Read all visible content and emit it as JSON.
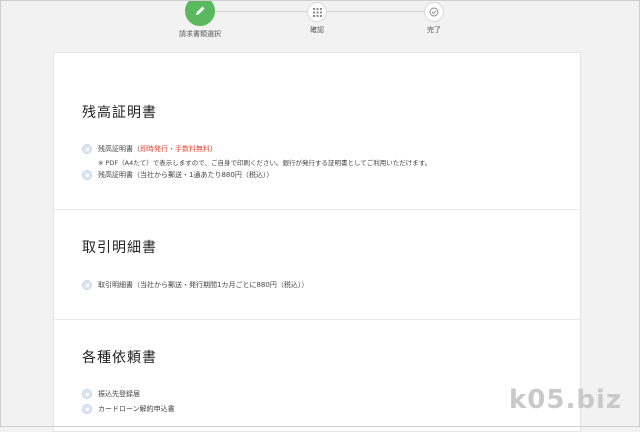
{
  "stepper": {
    "steps": [
      {
        "label": "請求書類選択",
        "icon": "pencil-icon"
      },
      {
        "label": "確認",
        "icon": "grid-icon"
      },
      {
        "label": "完了",
        "icon": "check-icon"
      }
    ],
    "active_color": "#59b860"
  },
  "sections": {
    "balance": {
      "title": "残高証明書",
      "option1_label": "残高証明書（",
      "option1_highlight": "即時発行・手数料無料",
      "option1_suffix": "）",
      "option1_note": "※ PDF（A4たて）で表示しますので、ご自身で印刷ください。銀行が発行する証明書としてご利用いただけます。",
      "option2_label": "残高証明書（当社から郵送・1通あたり880円（税込））"
    },
    "transactions": {
      "title": "取引明細書",
      "option1_label": "取引明細書（当社から郵送・発行期間1カ月ごとに880円（税込））"
    },
    "requests": {
      "title": "各種依頼書",
      "option1_label": "振込先登録届",
      "option2_label": "カードローン解約申込書"
    }
  },
  "watermark": "k05.biz",
  "colors": {
    "highlight": "#e24b3b",
    "radio": "#dbe8f3"
  }
}
